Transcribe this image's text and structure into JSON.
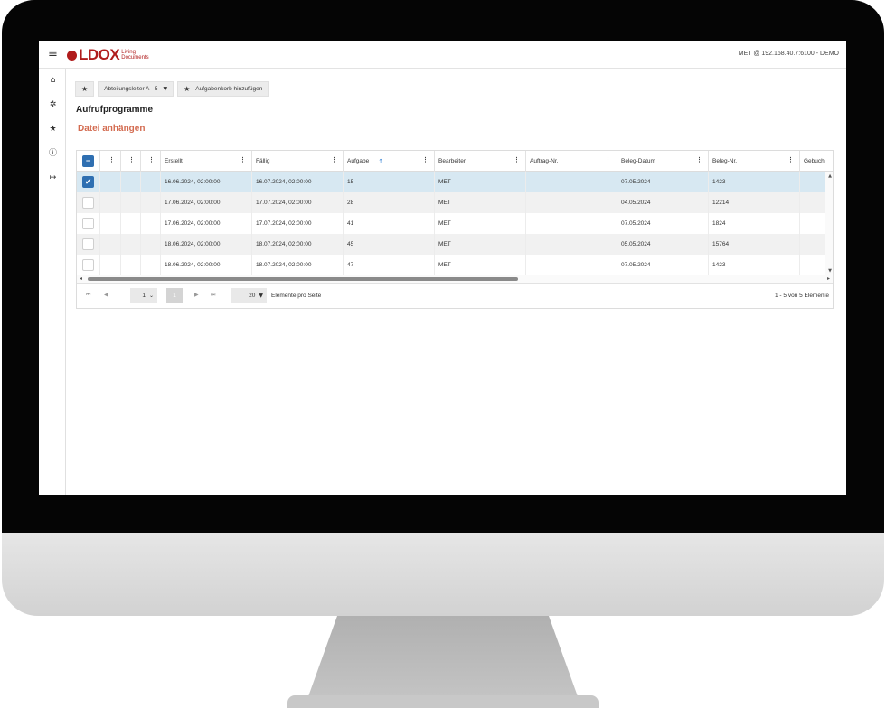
{
  "app": {
    "logo_main": "LDOX",
    "logo_sub1": "Living",
    "logo_sub2": "Documents",
    "connection": "MET @ 192.168.40.7:6100 - DEMO"
  },
  "sidebar": {
    "items": [
      {
        "icon": "home-icon",
        "glyph": "⌂"
      },
      {
        "icon": "settings-icon",
        "glyph": "✲"
      },
      {
        "icon": "star-icon",
        "glyph": "★"
      },
      {
        "icon": "info-icon",
        "glyph": "ⓘ"
      },
      {
        "icon": "logout-icon",
        "glyph": "↦"
      }
    ]
  },
  "toolbar": {
    "favorite_glyph": "★",
    "role_select": "Abteilungsleiter A - 5",
    "add_basket_label": "Aufgabenkorb hinzufügen"
  },
  "page": {
    "title": "Aufrufprogramme",
    "attach_link": "Datei anhängen"
  },
  "grid": {
    "columns": {
      "erstellt": "Erstellt",
      "faellig": "Fällig",
      "aufgabe": "Aufgabe",
      "bearbeiter": "Bearbeiter",
      "auftrag": "Auftrag-Nr.",
      "beleg_datum": "Beleg-Datum",
      "beleg_nr": "Beleg-Nr.",
      "gebucht": "Gebuch"
    },
    "rows": [
      {
        "checked": true,
        "erstellt": "16.06.2024, 02:00:00",
        "faellig": "16.07.2024, 02:00:00",
        "aufgabe": "15",
        "bearbeiter": "MET",
        "auftrag": "",
        "beleg_datum": "07.05.2024",
        "beleg_nr": "1423"
      },
      {
        "checked": false,
        "erstellt": "17.06.2024, 02:00:00",
        "faellig": "17.07.2024, 02:00:00",
        "aufgabe": "28",
        "bearbeiter": "MET",
        "auftrag": "",
        "beleg_datum": "04.05.2024",
        "beleg_nr": "12214"
      },
      {
        "checked": false,
        "erstellt": "17.06.2024, 02:00:00",
        "faellig": "17.07.2024, 02:00:00",
        "aufgabe": "41",
        "bearbeiter": "MET",
        "auftrag": "",
        "beleg_datum": "07.05.2024",
        "beleg_nr": "1824"
      },
      {
        "checked": false,
        "erstellt": "18.06.2024, 02:00:00",
        "faellig": "18.07.2024, 02:00:00",
        "aufgabe": "45",
        "bearbeiter": "MET",
        "auftrag": "",
        "beleg_datum": "05.05.2024",
        "beleg_nr": "15764"
      },
      {
        "checked": false,
        "erstellt": "18.06.2024, 02:00:00",
        "faellig": "18.07.2024, 02:00:00",
        "aufgabe": "47",
        "bearbeiter": "MET",
        "auftrag": "",
        "beleg_datum": "07.05.2024",
        "beleg_nr": "1423"
      }
    ]
  },
  "pager": {
    "page_select": "1",
    "current_page": "1",
    "page_size": "20",
    "page_size_label": "Elemente pro Seite",
    "count": "1 - 5 von 5 Elemente"
  },
  "colors": {
    "brand": "#b01c1c",
    "link": "#d36b50",
    "accent": "#2f6fb1",
    "selected_row": "#d7e8f2"
  }
}
